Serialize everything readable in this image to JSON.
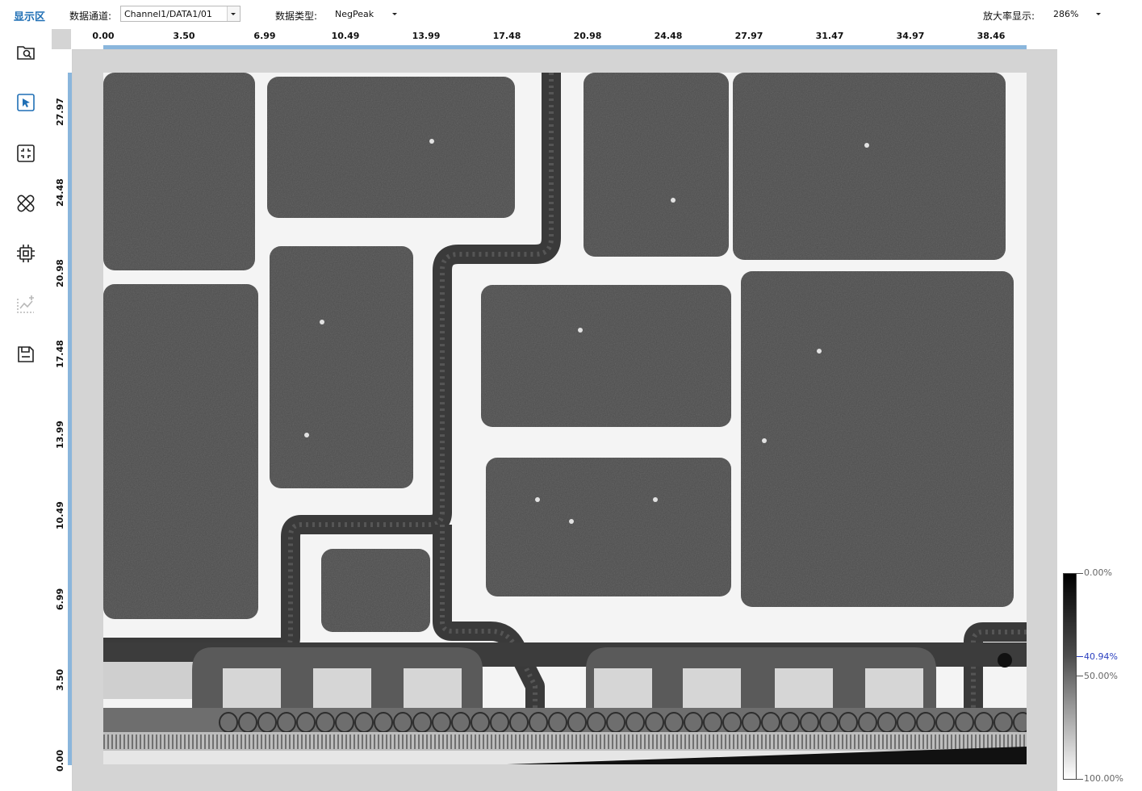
{
  "toolbar": {
    "title": "显示区",
    "channel_label": "数据通道:",
    "channel_value": "Channel1/DATA1/01",
    "type_label": "数据类型:",
    "type_value": "NegPeak",
    "zoom_label": "放大率显示:",
    "zoom_value": "286%"
  },
  "sidebar": {
    "items": [
      {
        "icon": "folder-search-icon"
      },
      {
        "icon": "pointer-select-icon"
      },
      {
        "icon": "fit-view-icon"
      },
      {
        "icon": "bandage-icon"
      },
      {
        "icon": "chip-icon"
      },
      {
        "icon": "chart-add-icon"
      },
      {
        "icon": "save-icon"
      }
    ]
  },
  "ruler_x": [
    "0.00",
    "3.50",
    "6.99",
    "10.49",
    "13.99",
    "17.48",
    "20.98",
    "24.48",
    "27.97",
    "31.47",
    "34.97",
    "38.46"
  ],
  "ruler_y": [
    "27.97",
    "24.48",
    "20.98",
    "17.48",
    "13.99",
    "10.49",
    "6.99",
    "3.50",
    "0.00"
  ],
  "color_scale": {
    "top": "0.00%",
    "marker": "40.94%",
    "mid": "50.00%",
    "bottom": "100.00%"
  },
  "colors": {
    "accent": "#1f6fb5",
    "ruler_band": "#8ab6dc",
    "pad": "#4a4a4a",
    "trace": "#3a3a3a",
    "background": "#f4f4f4"
  }
}
